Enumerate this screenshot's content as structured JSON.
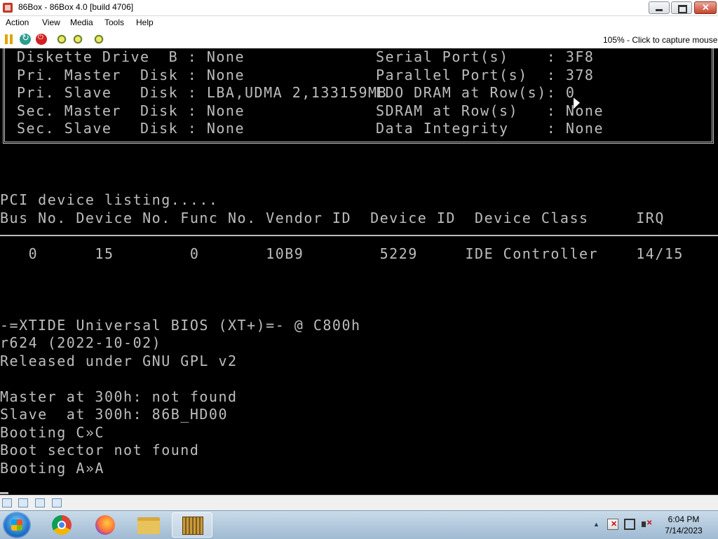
{
  "window": {
    "title": "86Box - 86Box 4.0 [build 4706]"
  },
  "menu": [
    "Action",
    "View",
    "Media",
    "Tools",
    "Help"
  ],
  "toolbar": {
    "capture_hint": "105% - Click to capture mouse"
  },
  "bios_summary": {
    "left": [
      "Diskette Drive  B : None",
      "Pri. Master  Disk : None",
      "Pri. Slave   Disk : LBA,UDMA 2,133159MB",
      "Sec. Master  Disk : None",
      "Sec. Slave   Disk : None"
    ],
    "right": [
      "Serial Port(s)    : 3F8",
      "Parallel Port(s)  : 378",
      "EDO DRAM at Row(s): 0",
      "SDRAM at Row(s)   : None",
      "Data Integrity    : None"
    ]
  },
  "pci": {
    "heading": "PCI device listing.....",
    "columns": "Bus No. Device No. Func No. Vendor ID  Device ID  Device Class     IRQ",
    "rows": [
      "   0      15        0       10B9        5229     IDE Controller    14/15"
    ]
  },
  "xtide": [
    "-=XTIDE Universal BIOS (XT+)=- @ C800h",
    "r624 (2022-10-02)",
    "Released under GNU GPL v2",
    "",
    "Master at 300h: not found",
    "Slave  at 300h: 86B_HD00",
    "Booting C»C",
    "Boot sector not found",
    "Booting A»A"
  ],
  "clock": {
    "time": "6:04 PM",
    "date": "7/14/2023"
  },
  "colors": {
    "screen_bg": "#000000",
    "screen_text": "#bdbdbd",
    "taskbar": "#b4cbe0"
  }
}
